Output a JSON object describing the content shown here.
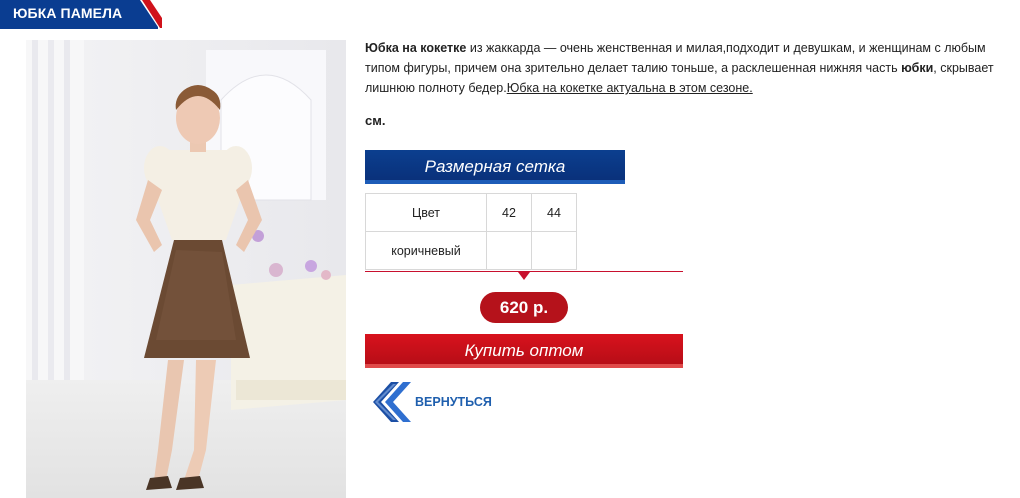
{
  "product": {
    "title": "ЮБКА ПАМЕЛА",
    "description": {
      "lead_bold": "Юбка на кокетке",
      "text_1": " из жаккарда — очень женственная и милая,подходит и девушкам, и женщинам с любым типом фигуры, причем она зрительно делает талию тоньше, а расклешенная нижняя часть ",
      "bold_2": "юбки",
      "text_2": ", скрывает лишнюю полноту бедер.",
      "link_text": "Юбка на кокетке актуальна в этом  сезоне."
    },
    "size_unit": "см."
  },
  "size_grid": {
    "title": "Размерная сетка",
    "header": [
      "Цвет",
      "42",
      "44"
    ],
    "rows": [
      [
        "коричневый",
        "",
        ""
      ]
    ]
  },
  "price": "620 р.",
  "buy_button": "Купить оптом",
  "back_link": "ВЕРНУТЬСЯ",
  "colors": {
    "brand_blue": "#0a3d91",
    "brand_red": "#c8102e",
    "link_blue": "#1f5fae"
  }
}
